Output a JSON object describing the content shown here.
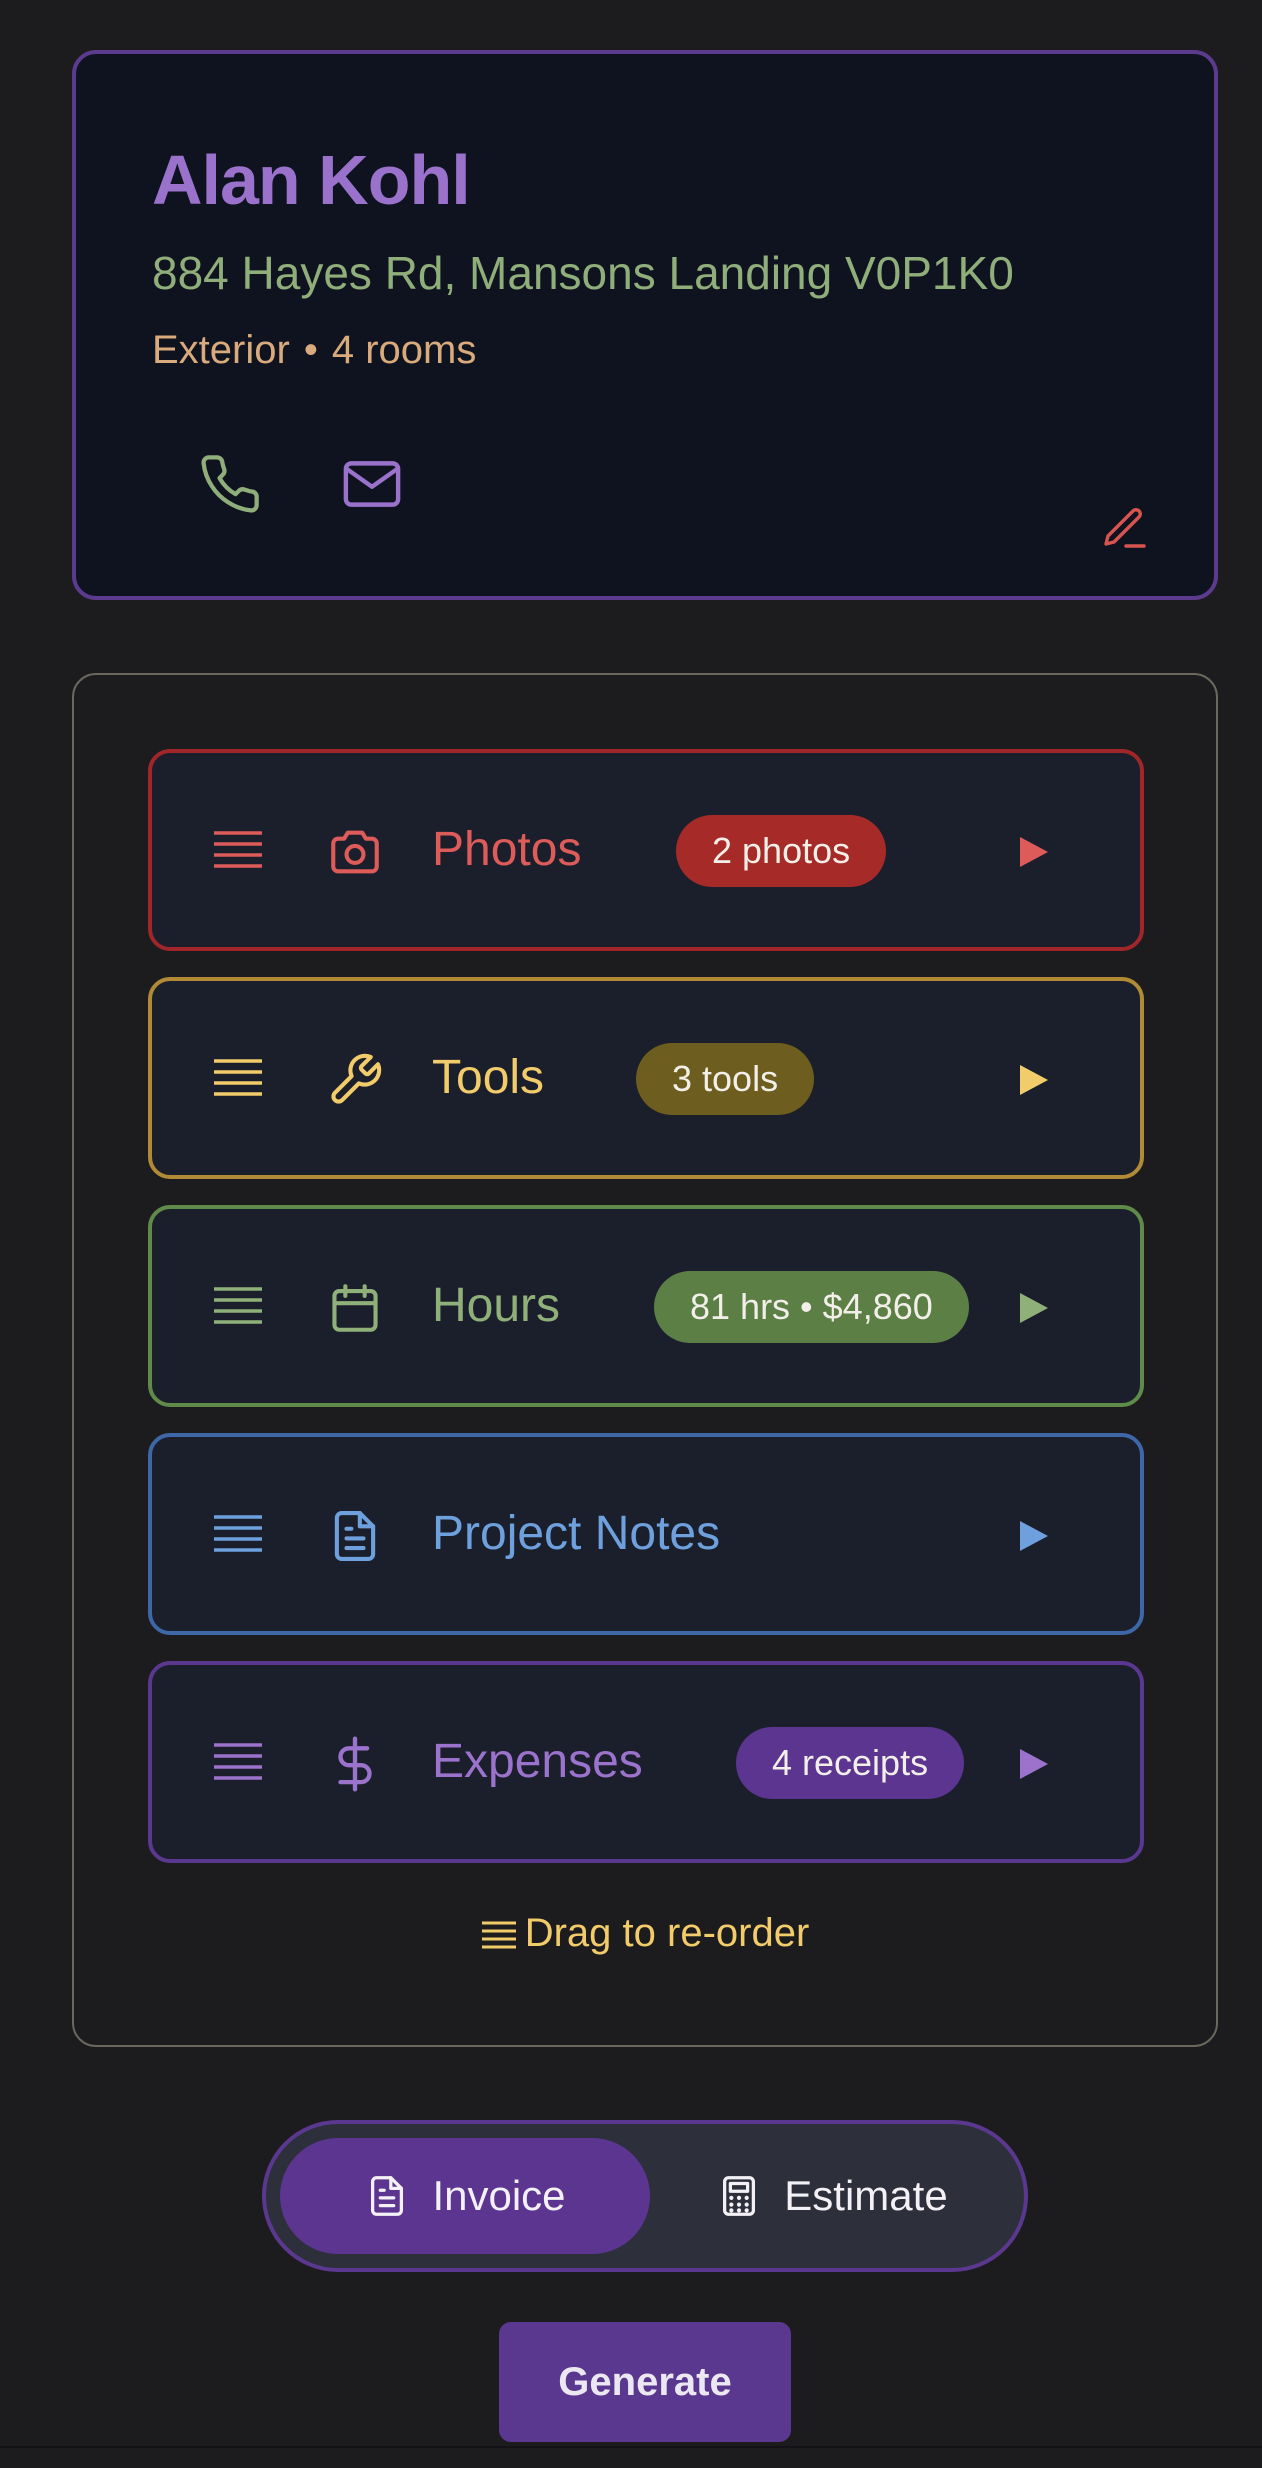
{
  "client": {
    "name": "Alan Kohl",
    "address": "884 Hayes Rd, Mansons Landing V0P1K0",
    "job_type": "Exterior",
    "separator": "•",
    "rooms": "4 rooms",
    "icons": {
      "phone": "phone-icon",
      "email": "mail-icon",
      "edit": "pencil-icon"
    },
    "colors": {
      "name": "#9a72cc",
      "address": "#8fae7a",
      "meta": "#d8aa7c",
      "border": "#5c3b8e"
    }
  },
  "sections": [
    {
      "id": "photos",
      "label": "Photos",
      "badge": "2 photos",
      "icon": "camera-icon",
      "color": "#dd5b59"
    },
    {
      "id": "tools",
      "label": "Tools",
      "badge": "3 tools",
      "icon": "wrench-icon",
      "color": "#f2cb6a"
    },
    {
      "id": "hours",
      "label": "Hours",
      "badge": "81 hrs • $4,860",
      "icon": "calendar-icon",
      "color": "#90b07a"
    },
    {
      "id": "notes",
      "label": "Project Notes",
      "badge": "",
      "icon": "document-icon",
      "color": "#6da0dd"
    },
    {
      "id": "expenses",
      "label": "Expenses",
      "badge": "4 receipts",
      "icon": "dollar-icon",
      "color": "#9b72cc"
    }
  ],
  "drag_hint": "Drag to re-order",
  "doc_toggle": {
    "options": [
      {
        "label": "Invoice",
        "icon": "document-icon",
        "selected": true
      },
      {
        "label": "Estimate",
        "icon": "calculator-icon",
        "selected": false
      }
    ],
    "accent": "#5c3591"
  },
  "generate_label": "Generate"
}
